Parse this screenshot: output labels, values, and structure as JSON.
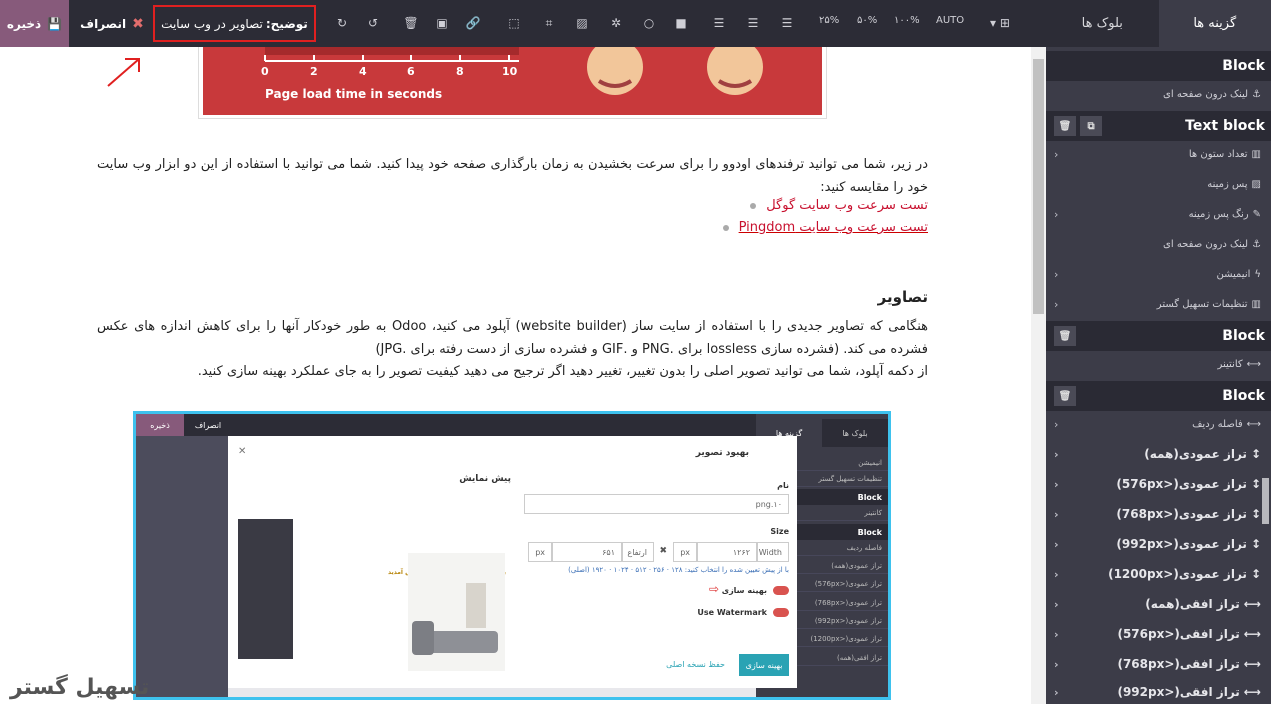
{
  "topbar": {
    "save_label": "ذخیره",
    "discard_label": "انصراف",
    "alt_label": "توضیح:",
    "alt_value": "تصاویر در وب سایت",
    "zoom": [
      "AUTO",
      "۱۰۰%",
      "۵۰%",
      "۲۵%"
    ]
  },
  "sidebar": {
    "tabs": [
      "بلوک ها",
      "گزینه ها"
    ],
    "active_tab": "گزینه ها",
    "groups": [
      {
        "title": "Block",
        "items": [
          "لینک درون صفحه ای"
        ]
      },
      {
        "title": "Text block",
        "items": [
          "تعداد ستون ها",
          "پس زمینه",
          "رنگ پس زمینه",
          "لینک درون صفحه ای",
          "انیمیشن",
          "تنظیمات تسهیل گستر"
        ]
      },
      {
        "title": "Block",
        "items": [
          "کانتینر"
        ]
      },
      {
        "title": "Block",
        "items": [
          "فاصله ردیف",
          "تراز عمودی(همه)",
          "تراز عمودی(<576px)",
          "تراز عمودی(<768px)",
          "تراز عمودی(<992px)",
          "تراز عمودی(<1200px)",
          "تراز افقی(همه)",
          "تراز افقی(<576px)",
          "تراز افقی(<768px)",
          "تراز افقی(<992px)"
        ]
      }
    ]
  },
  "figure": {
    "ticks": [
      "0",
      "2",
      "4",
      "6",
      "8",
      "10"
    ],
    "caption": "Page load time in seconds"
  },
  "article": {
    "intro": "در زیر، شما می توانید ترفندهای اودوو را برای سرعت بخشیدن به زمان بارگذاری صفحه خود پیدا کنید. شما می توانید با استفاده از این دو ابزار وب سایت خود را مقایسه کنید:",
    "links": [
      "تست سرعت وب سایت گوگل",
      "تست سرعت وب سایت Pingdom"
    ],
    "heading": "تصاویر",
    "para1": "هنگامی که تصاویر جدیدی را با استفاده از سایت ساز (website builder) آپلود می کنید، Odoo به طور خودکار آنها را برای کاهش اندازه های عکس فشرده می کند. (فشرده سازی lossless برای .PNG و .GIF و فشرده سازی از دست رفته برای .JPG)",
    "para2": "از دکمه آپلود، شما می توانید تصویر اصلی را بدون تغییر، تغییر دهید اگر ترجیح می دهید کیفیت تصویر را به جای عملکرد بهینه سازی کنید."
  },
  "inner": {
    "save": "ذخیره",
    "discard": "انصراف",
    "tabs": [
      "بلوک ها",
      "گزینه ها"
    ],
    "side_rows": [
      "انیمیشن",
      "تنظیمات تسهیل گستر",
      "Block",
      "کانتینر",
      "Block",
      "فاصله ردیف",
      "تراز عمودی(همه)",
      "تراز عمودی(<576px)",
      "تراز عمودی(<768px)",
      "تراز عمودی(<992px)",
      "تراز عمودی(<1200px)",
      "تراز افقی(همه)"
    ],
    "modal": {
      "title": "بهبود تصویر",
      "preview": "پیش نمایش",
      "name_label": "نام",
      "name_value": "png.۱۰",
      "size_label": "Size",
      "width_label": "Width",
      "width_value": "۱۲۶۲",
      "height_label": "ارتفاع",
      "height_value": "۶۵۱",
      "unit": "px",
      "note": "با از پیش تعیین شده را انتخاب کنید: ۱۲۸ · ۲۵۶ · ۵۱۲ · ۱۰۲۴ · ۱۹۲۰ (اصلی)",
      "optimize_label": "بهینه سازی",
      "watermark_label": "Use Watermark",
      "primary_btn": "بهینه سازی",
      "keep_link": "حفظ نسخه اصلی",
      "preview_caption": "به فروشگاه اینترنتی مبلمان خوش آمدید"
    }
  },
  "watermark": "تسهیل گستر"
}
